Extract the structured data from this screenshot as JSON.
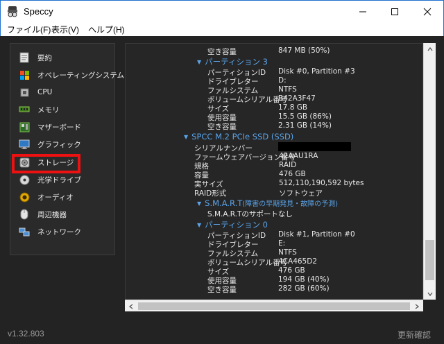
{
  "window": {
    "title": "Speccy"
  },
  "menu": [
    "ファイル(F)",
    "表示(V)",
    "ヘルプ(H)"
  ],
  "sidebar": {
    "items": [
      {
        "label": "要約",
        "icon": "summary-icon"
      },
      {
        "label": "オペレーティングシステム",
        "icon": "windows-icon"
      },
      {
        "label": "CPU",
        "icon": "cpu-icon"
      },
      {
        "label": "メモリ",
        "icon": "memory-icon"
      },
      {
        "label": "マザーボード",
        "icon": "motherboard-icon"
      },
      {
        "label": "グラフィック",
        "icon": "monitor-icon"
      },
      {
        "label": "ストレージ",
        "icon": "storage-icon"
      },
      {
        "label": "光学ドライブ",
        "icon": "optical-drive-icon"
      },
      {
        "label": "オーディオ",
        "icon": "audio-icon"
      },
      {
        "label": "周辺機器",
        "icon": "mouse-icon"
      },
      {
        "label": "ネットワーク",
        "icon": "network-icon"
      }
    ],
    "selected": "ストレージ",
    "highlight_color": "#ee1111"
  },
  "content": {
    "top_free": {
      "key": "空き容量",
      "value": "847 MB (50%)"
    },
    "partition3": {
      "title": "パーティション 3",
      "rows": [
        {
          "key": "パーティションID",
          "value": "Disk #0, Partition #3"
        },
        {
          "key": "ドライブレター",
          "value": "D:"
        },
        {
          "key": "ファルシステム",
          "value": "NTFS"
        },
        {
          "key": "ボリュームシリアル番号",
          "value": "B42A3F47"
        },
        {
          "key": "サイズ",
          "value": "17.8 GB"
        },
        {
          "key": "使用容量",
          "value": "15.5 GB (86%)"
        },
        {
          "key": "空き容量",
          "value": "2.31 GB (14%)"
        }
      ]
    },
    "disk": {
      "title": "SPCC M.2 PCIe SSD (SSD)",
      "rows": [
        {
          "key": "シリアルナンバー",
          "value": ""
        },
        {
          "key": "ファームウェアバージョン番号",
          "value": "42AAU1RA"
        },
        {
          "key": "規格",
          "value": "RAID"
        },
        {
          "key": "容量",
          "value": "476 GB"
        },
        {
          "key": "実サイズ",
          "value": "512,110,190,592 bytes"
        },
        {
          "key": "RAID形式",
          "value": "ソフトウェア"
        }
      ]
    },
    "smart": {
      "title": "S.M.A.R.T",
      "subtitle": "(障害の早期発見・故障の予測)",
      "note": "S.M.A.R.Tのサポートなし"
    },
    "partition0": {
      "title": "パーティション 0",
      "rows": [
        {
          "key": "パーティションID",
          "value": "Disk #1, Partition #0"
        },
        {
          "key": "ドライブレター",
          "value": "E:"
        },
        {
          "key": "ファルシステム",
          "value": "NTFS"
        },
        {
          "key": "ボリュームシリアル番号",
          "value": "4CA465D2"
        },
        {
          "key": "サイズ",
          "value": "476 GB"
        },
        {
          "key": "使用容量",
          "value": "194 GB (40%)"
        },
        {
          "key": "空き容量",
          "value": "282 GB (60%)"
        }
      ]
    }
  },
  "status": {
    "version": "v1.32.803",
    "update": "更新確認"
  },
  "colors": {
    "accent": "#5aa4ea",
    "background": "#232323",
    "title_border": "#1e6fd0"
  }
}
